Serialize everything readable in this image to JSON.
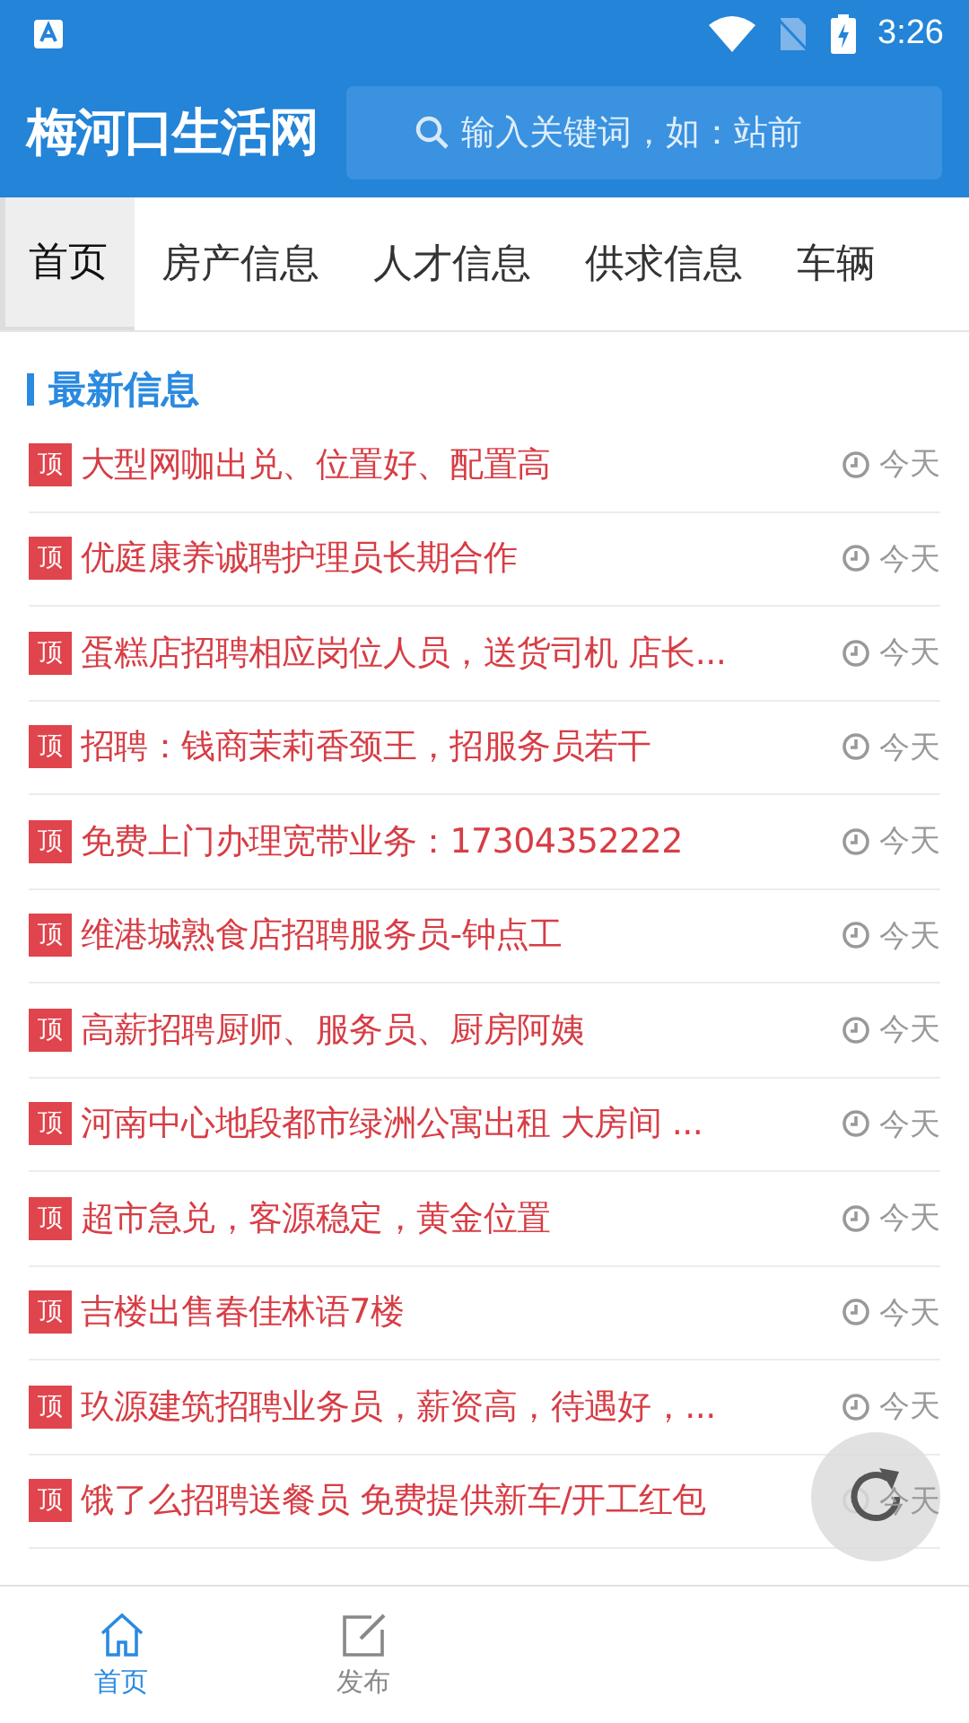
{
  "status_bar": {
    "time": "3:26"
  },
  "header": {
    "logo": "梅河口生活网",
    "search": {
      "placeholder": "输入关键词，如：站前"
    }
  },
  "tabs": [
    {
      "label": "首页",
      "selected": true
    },
    {
      "label": "房产信息",
      "selected": false
    },
    {
      "label": "人才信息",
      "selected": false
    },
    {
      "label": "供求信息",
      "selected": false
    },
    {
      "label": "车辆",
      "selected": false
    }
  ],
  "section": {
    "title": "最新信息"
  },
  "items": [
    {
      "badge": "顶",
      "title": "大型网咖出兑、位置好、配置高",
      "time": "今天"
    },
    {
      "badge": "顶",
      "title": "优庭康养诚聘护理员长期合作",
      "time": "今天"
    },
    {
      "badge": "顶",
      "title": "蛋糕店招聘相应岗位人员，送货司机 店长...",
      "time": "今天"
    },
    {
      "badge": "顶",
      "title": "招聘：钱商茉莉香颈王，招服务员若干",
      "time": "今天"
    },
    {
      "badge": "顶",
      "title": "免费上门办理宽带业务：17304352222",
      "time": "今天"
    },
    {
      "badge": "顶",
      "title": "维港城熟食店招聘服务员-钟点工",
      "time": "今天"
    },
    {
      "badge": "顶",
      "title": "高薪招聘厨师、服务员、厨房阿姨",
      "time": "今天"
    },
    {
      "badge": "顶",
      "title": "河南中心地段都市绿洲公寓出租 大房间 ...",
      "time": "今天"
    },
    {
      "badge": "顶",
      "title": "超市急兑，客源稳定，黄金位置",
      "time": "今天"
    },
    {
      "badge": "顶",
      "title": "吉楼出售春佳林语7楼",
      "time": "今天"
    },
    {
      "badge": "顶",
      "title": "玖源建筑招聘业务员，薪资高，待遇好，...",
      "time": "今天"
    },
    {
      "badge": "顶",
      "title": "饿了么招聘送餐员 免费提供新车/开工红包",
      "time": "今天"
    }
  ],
  "bottom_nav": [
    {
      "label": "首页",
      "kind": "home",
      "selected": true
    },
    {
      "label": "发布",
      "kind": "edit",
      "selected": false
    }
  ]
}
